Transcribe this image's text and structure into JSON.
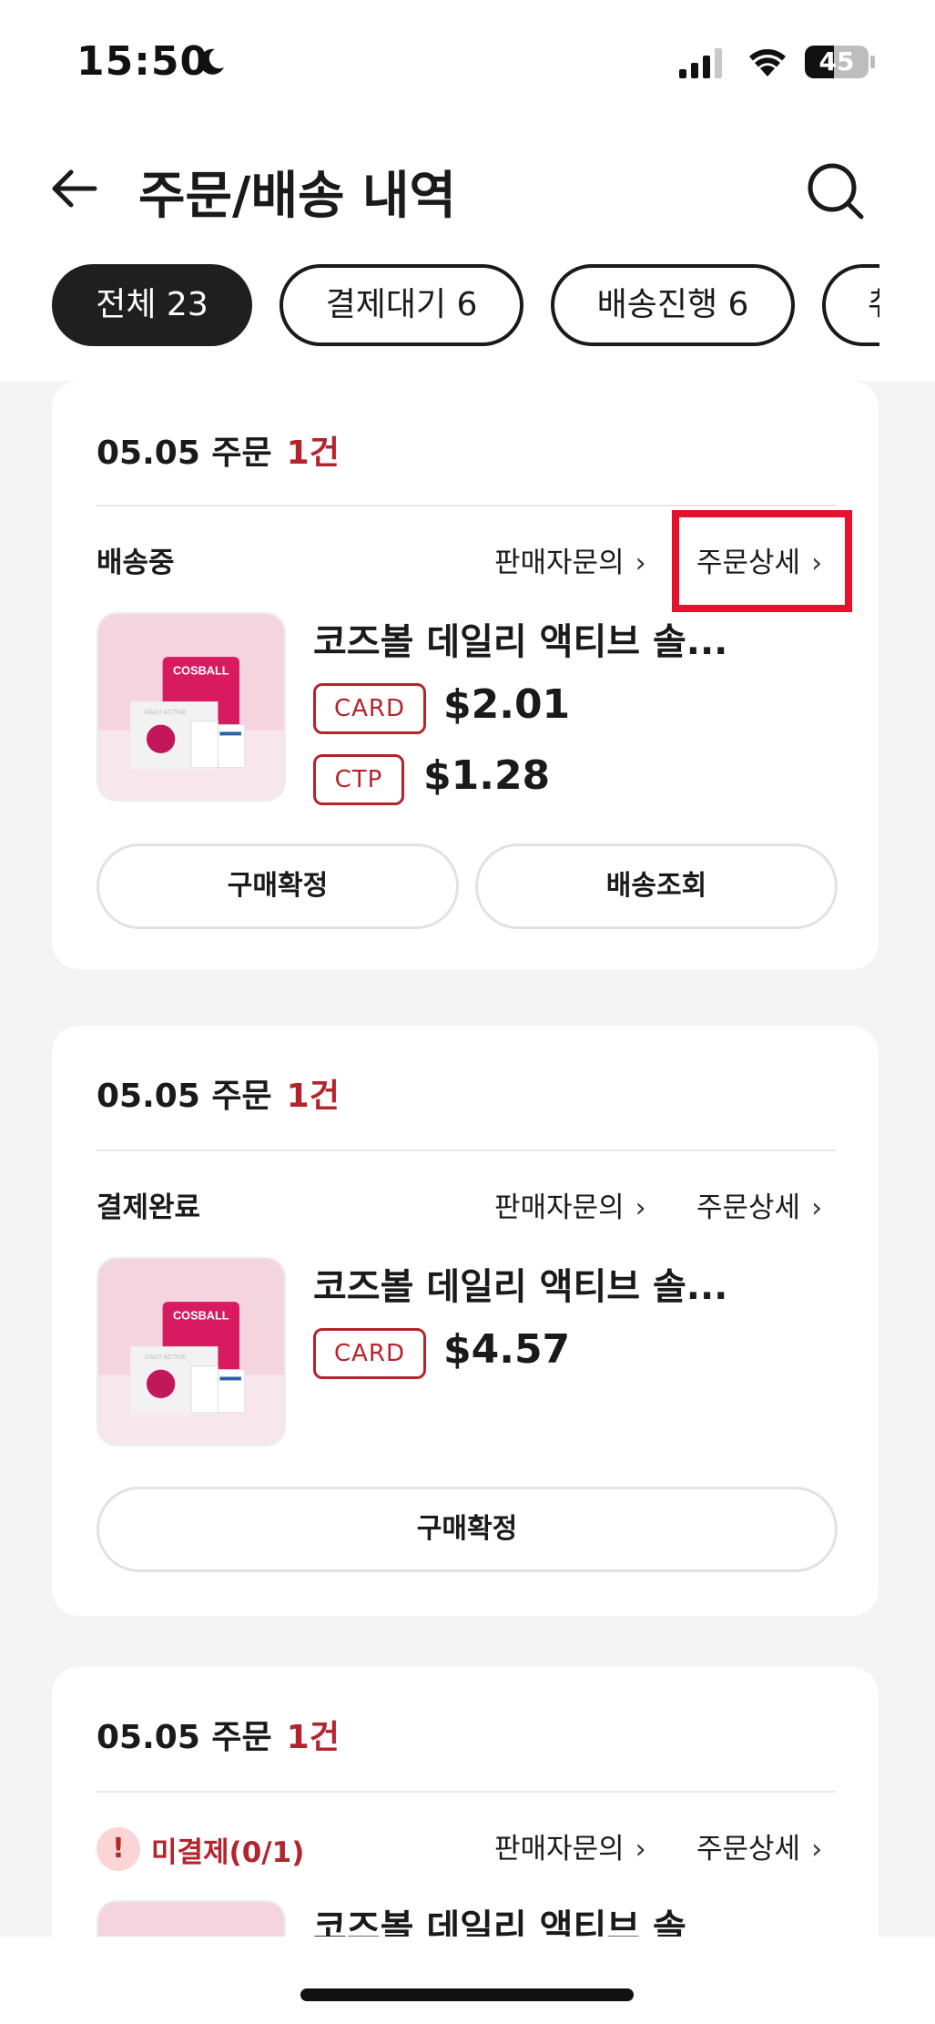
{
  "status_bar": {
    "time": "15:50",
    "battery_level": "45",
    "battery_fraction": 0.45
  },
  "header": {
    "title": "주문/배송 내역"
  },
  "tabs": [
    {
      "label": "전체 23",
      "active": true
    },
    {
      "label": "결제대기 6",
      "active": false
    },
    {
      "label": "배송진행 6",
      "active": false
    },
    {
      "label": "취",
      "active": false
    }
  ],
  "orders": [
    {
      "date": "05.05 주문",
      "count": "1건",
      "status": "배송중",
      "seller_inquiry": "판매자문의",
      "order_detail": "주문상세",
      "product_name": "코즈볼 데일리 액티브 솔...",
      "prices": [
        {
          "method": "CARD",
          "amount": "$2.01"
        },
        {
          "method": "CTP",
          "amount": "$1.28"
        }
      ],
      "actions": [
        "구매확정",
        "배송조회"
      ]
    },
    {
      "date": "05.05 주문",
      "count": "1건",
      "status": "결제완료",
      "seller_inquiry": "판매자문의",
      "order_detail": "주문상세",
      "product_name": "코즈볼 데일리 액티브 솔...",
      "prices": [
        {
          "method": "CARD",
          "amount": "$4.57"
        }
      ],
      "actions": [
        "구매확정"
      ]
    },
    {
      "date": "05.05 주문",
      "count": "1건",
      "status": "미결제(0/1)",
      "alert_glyph": "!",
      "seller_inquiry": "판매자문의",
      "order_detail": "주문상세",
      "product_name": "코즈볼 데일리 액티브 솔"
    }
  ],
  "product_image": {
    "brand": "COSBALL",
    "line": "DAILY ACTIVE"
  },
  "colors": {
    "accent_red": "#b3242c",
    "highlight": "#e8112d",
    "active_tab_bg": "#1f1f1f",
    "background": "#f4f4f5"
  },
  "icons": {
    "back": "arrow-left-icon",
    "search": "search-icon",
    "chevron": "chevron-right-icon",
    "moon": "moon-icon",
    "signal": "signal-icon",
    "wifi": "wifi-icon"
  }
}
